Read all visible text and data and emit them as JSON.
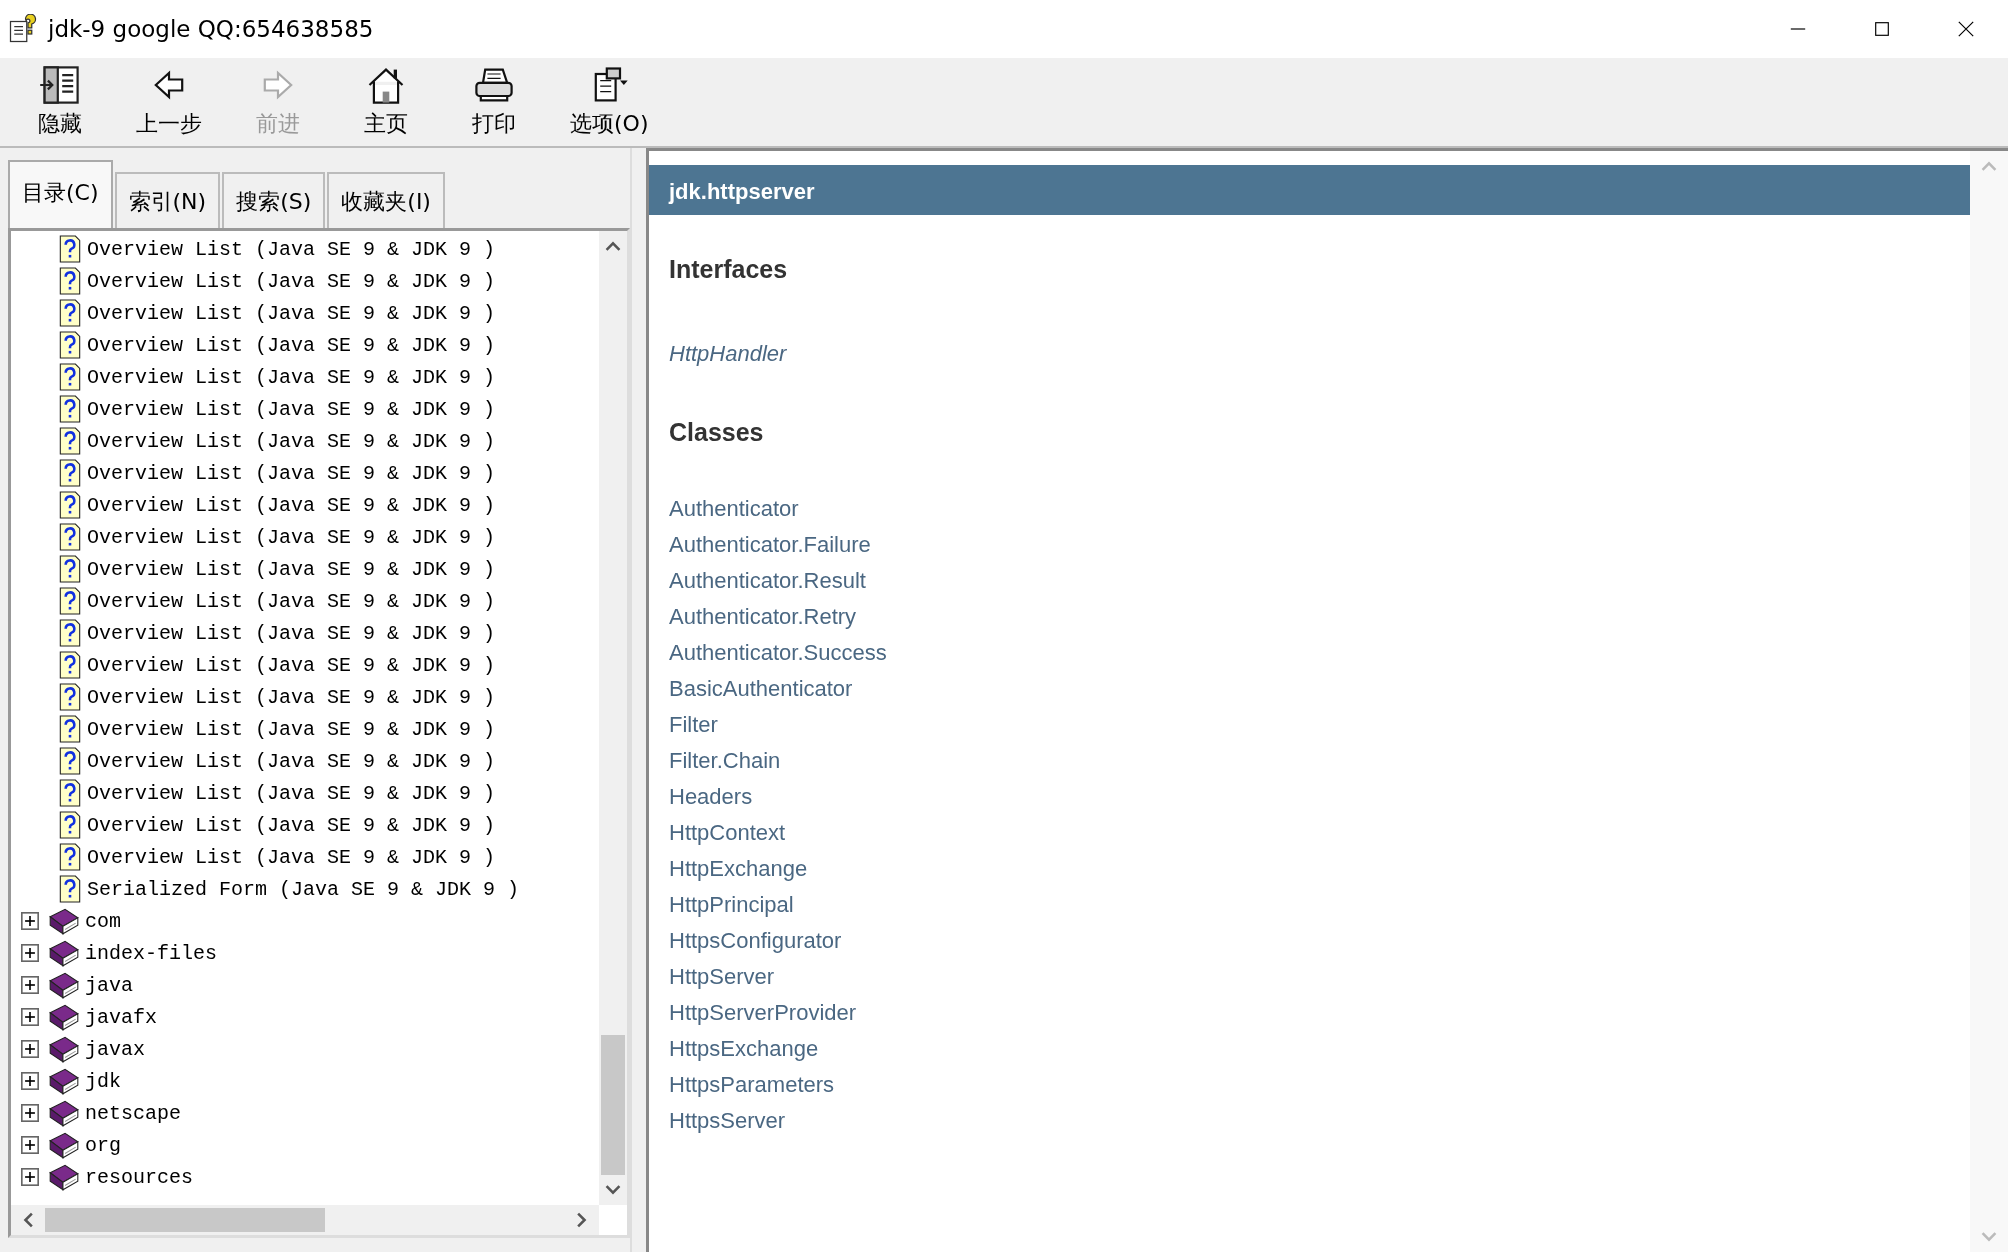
{
  "window": {
    "title": "jdk-9 google QQ:654638585"
  },
  "toolbar": [
    {
      "kind": "hide",
      "label": "隐藏",
      "disabled": false
    },
    {
      "kind": "back",
      "label": "上一步",
      "disabled": false
    },
    {
      "kind": "forward",
      "label": "前进",
      "disabled": true
    },
    {
      "kind": "home",
      "label": "主页",
      "disabled": false
    },
    {
      "kind": "print",
      "label": "打印",
      "disabled": false
    },
    {
      "kind": "options",
      "label": "选项(O)",
      "disabled": false
    }
  ],
  "tabs": [
    {
      "label": "目录(C)",
      "selected": true
    },
    {
      "label": "索引(N)",
      "selected": false
    },
    {
      "label": "搜索(S)",
      "selected": false
    },
    {
      "label": "收藏夹(I)",
      "selected": false
    }
  ],
  "tree": [
    {
      "kind": "page",
      "label": "Overview List (Java SE 9 & JDK 9 )"
    },
    {
      "kind": "page",
      "label": "Overview List (Java SE 9 & JDK 9 )"
    },
    {
      "kind": "page",
      "label": "Overview List (Java SE 9 & JDK 9 )"
    },
    {
      "kind": "page",
      "label": "Overview List (Java SE 9 & JDK 9 )"
    },
    {
      "kind": "page",
      "label": "Overview List (Java SE 9 & JDK 9 )"
    },
    {
      "kind": "page",
      "label": "Overview List (Java SE 9 & JDK 9 )"
    },
    {
      "kind": "page",
      "label": "Overview List (Java SE 9 & JDK 9 )"
    },
    {
      "kind": "page",
      "label": "Overview List (Java SE 9 & JDK 9 )"
    },
    {
      "kind": "page",
      "label": "Overview List (Java SE 9 & JDK 9 )"
    },
    {
      "kind": "page",
      "label": "Overview List (Java SE 9 & JDK 9 )"
    },
    {
      "kind": "page",
      "label": "Overview List (Java SE 9 & JDK 9 )"
    },
    {
      "kind": "page",
      "label": "Overview List (Java SE 9 & JDK 9 )"
    },
    {
      "kind": "page",
      "label": "Overview List (Java SE 9 & JDK 9 )"
    },
    {
      "kind": "page",
      "label": "Overview List (Java SE 9 & JDK 9 )"
    },
    {
      "kind": "page",
      "label": "Overview List (Java SE 9 & JDK 9 )"
    },
    {
      "kind": "page",
      "label": "Overview List (Java SE 9 & JDK 9 )"
    },
    {
      "kind": "page",
      "label": "Overview List (Java SE 9 & JDK 9 )"
    },
    {
      "kind": "page",
      "label": "Overview List (Java SE 9 & JDK 9 )"
    },
    {
      "kind": "page",
      "label": "Overview List (Java SE 9 & JDK 9 )"
    },
    {
      "kind": "page",
      "label": "Overview List (Java SE 9 & JDK 9 )"
    },
    {
      "kind": "page",
      "label": "Serialized Form (Java SE 9 & JDK 9 )"
    },
    {
      "kind": "book",
      "label": "com",
      "expanded": false
    },
    {
      "kind": "book",
      "label": "index-files",
      "expanded": false
    },
    {
      "kind": "book",
      "label": "java",
      "expanded": false
    },
    {
      "kind": "book",
      "label": "javafx",
      "expanded": false
    },
    {
      "kind": "book",
      "label": "javax",
      "expanded": false
    },
    {
      "kind": "book",
      "label": "jdk",
      "expanded": false
    },
    {
      "kind": "book",
      "label": "netscape",
      "expanded": false
    },
    {
      "kind": "book",
      "label": "org",
      "expanded": false
    },
    {
      "kind": "book",
      "label": "resources",
      "expanded": false
    }
  ],
  "content": {
    "header": "jdk.httpserver",
    "sections": [
      {
        "heading": "Interfaces",
        "italic": true,
        "links": [
          "HttpHandler"
        ]
      },
      {
        "heading": "Classes",
        "italic": false,
        "links": [
          "Authenticator",
          "Authenticator.Failure",
          "Authenticator.Result",
          "Authenticator.Retry",
          "Authenticator.Success",
          "BasicAuthenticator",
          "Filter",
          "Filter.Chain",
          "Headers",
          "HttpContext",
          "HttpExchange",
          "HttpPrincipal",
          "HttpsConfigurator",
          "HttpServer",
          "HttpServerProvider",
          "HttpsExchange",
          "HttpsParameters",
          "HttpsServer"
        ]
      }
    ]
  }
}
